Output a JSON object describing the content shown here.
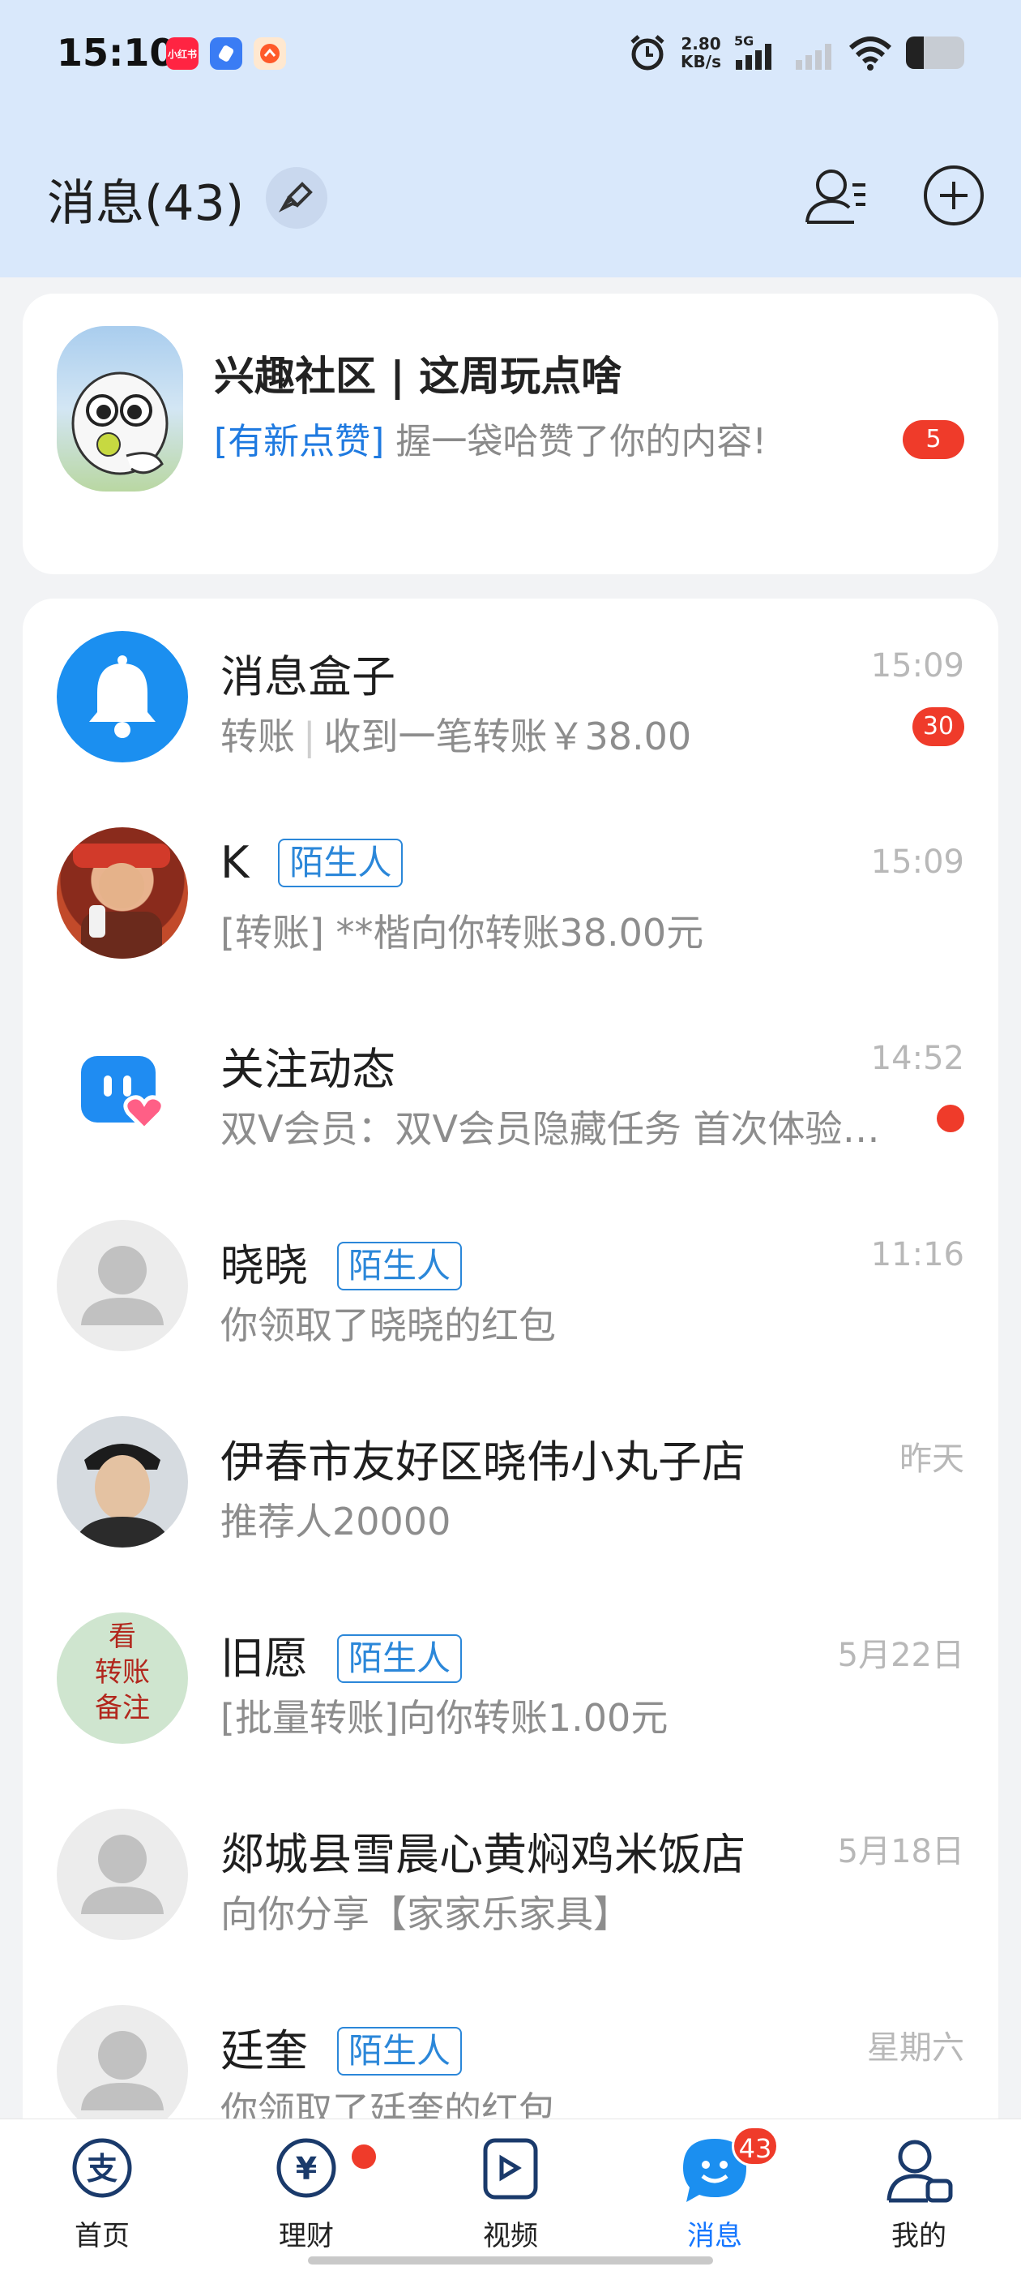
{
  "status_bar": {
    "time": "15:10",
    "apps": [
      {
        "name": "xiaohongshu-app-icon",
        "label": "小红书",
        "color": "#ff2442"
      },
      {
        "name": "blue-app-icon",
        "label": "",
        "color": "#3a7cf4"
      },
      {
        "name": "orange-app-icon",
        "label": "",
        "color": "#ff5a2a"
      }
    ],
    "net_speed_value": "2.80",
    "net_speed_unit": "KB/s",
    "network": "5G"
  },
  "header": {
    "title": "消息(43)"
  },
  "featured": {
    "title": "兴趣社区 | 这周玩点啥",
    "tag": "[有新点赞]",
    "message": " 握一袋哈赞了你的内容!",
    "badge": "5"
  },
  "conversations": [
    {
      "name": "消息盒子",
      "tag": "",
      "message_prefix": "转账",
      "message": "收到一笔转账￥38.00",
      "time": "15:09",
      "badge": "30",
      "avatar": "bell-icon"
    },
    {
      "name": "K",
      "tag": "陌生人",
      "message": "[转账] **楷向你转账38.00元",
      "time": "15:09",
      "avatar": "photo-avatar"
    },
    {
      "name": "关注动态",
      "tag": "",
      "message": "双V会员：双V会员隐藏任务 首次体验送…",
      "time": "14:52",
      "dot": true,
      "avatar": "follow-icon"
    },
    {
      "name": "晓晓",
      "tag": "陌生人",
      "message": "你领取了晓晓的红包",
      "time": "11:16",
      "avatar": "default-avatar"
    },
    {
      "name": "伊春市友好区晓伟小丸子店",
      "tag": "",
      "message": "推荐人20000",
      "time": "昨天",
      "avatar": "photo-avatar"
    },
    {
      "name": "旧愿",
      "tag": "陌生人",
      "message": "[批量转账]向你转账1.00元",
      "time": "5月22日",
      "avatar": "text-avatar",
      "avatar_text": [
        "看",
        "转账",
        "备注"
      ]
    },
    {
      "name": "郯城县雪晨心黄焖鸡米饭店",
      "tag": "",
      "message": "向你分享【家家乐家具】",
      "time": "5月18日",
      "avatar": "default-avatar"
    },
    {
      "name": "廷奎",
      "tag": "陌生人",
      "message": "你领取了廷奎的红包",
      "time": "星期六",
      "avatar": "default-avatar"
    }
  ],
  "bottom_nav": [
    {
      "label": "首页",
      "icon": "alipay-home-icon"
    },
    {
      "label": "理财",
      "icon": "finance-icon",
      "dot": true
    },
    {
      "label": "视频",
      "icon": "video-icon"
    },
    {
      "label": "消息",
      "icon": "message-icon",
      "badge": "43",
      "active": true
    },
    {
      "label": "我的",
      "icon": "profile-icon"
    }
  ],
  "colors": {
    "accent": "#1677ff",
    "badge": "#ef3b2a",
    "header_bg": "#d9e8fb"
  }
}
